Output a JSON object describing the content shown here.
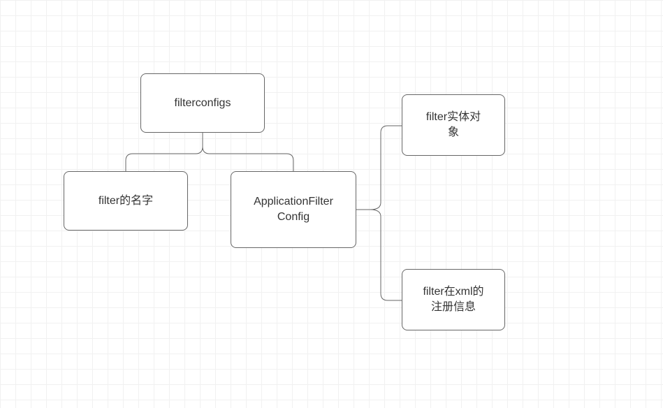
{
  "chart_data": {
    "type": "diagram",
    "title": "",
    "nodes": [
      {
        "id": "root",
        "label": "filterconfigs"
      },
      {
        "id": "name",
        "label": "filter的名字"
      },
      {
        "id": "appcfg",
        "label": "ApplicationFilter\nConfig"
      },
      {
        "id": "entity",
        "label": "filter实体对\n象"
      },
      {
        "id": "xmlreg",
        "label": "filter在xml的\n注册信息"
      }
    ],
    "edges": [
      {
        "from": "root",
        "to": "name"
      },
      {
        "from": "root",
        "to": "appcfg"
      },
      {
        "from": "appcfg",
        "to": "entity"
      },
      {
        "from": "appcfg",
        "to": "xmlreg"
      }
    ]
  },
  "nodes": {
    "root": "filterconfigs",
    "name": "filter的名字",
    "appcfg_l1": "ApplicationFilter",
    "appcfg_l2": "Config",
    "entity_l1": "filter实体对",
    "entity_l2": "象",
    "xmlreg_l1": "filter在xml的",
    "xmlreg_l2": "注册信息"
  }
}
